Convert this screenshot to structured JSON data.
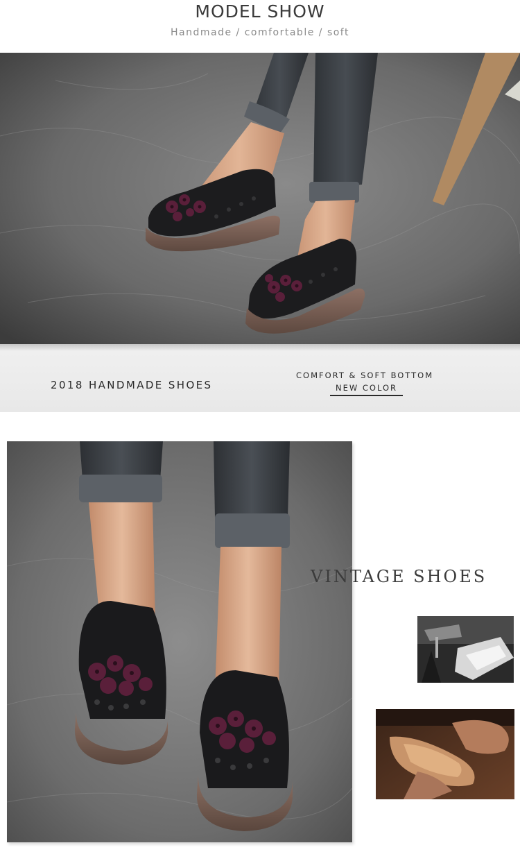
{
  "header": {
    "title": "MODEL SHOW",
    "subtitle": "Handmade / comfortable / soft"
  },
  "banner": {
    "left_text": "2018 HANDMADE SHOES",
    "right_top": "COMFORT & SOFT BOTTOM",
    "right_bottom": "NEW COLOR"
  },
  "section2": {
    "heading": "VINTAGE SHOES"
  },
  "colors": {
    "backdrop_gray": "#6d6d6d",
    "shoe_black": "#1c1c1e",
    "sole_brown": "#7e6458",
    "flower_plum": "#5a1f3a",
    "denim": "#3c4045",
    "skin": "#d9a886"
  }
}
